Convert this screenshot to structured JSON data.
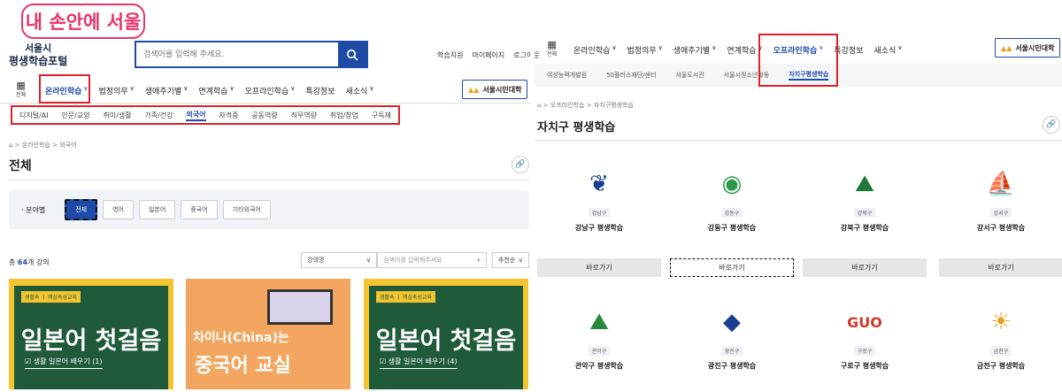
{
  "watermark": "내 손안에 서울",
  "left": {
    "brand": {
      "line1": "서울시",
      "line2": "평생학습포털"
    },
    "search": {
      "placeholder": "검색어를 입력해 주세요."
    },
    "top_links": [
      "학습지원",
      "마이페이지",
      "로그아웃"
    ],
    "grid_label": "전체",
    "gnb": [
      "온라인학습",
      "법정의무",
      "생애주기별",
      "연계학습",
      "오프라인학습",
      "특강정보",
      "새소식"
    ],
    "univ_button": "서울시민대학",
    "sub_menu": [
      "디지털/AI",
      "인문/교양",
      "취미/생활",
      "가족/건강",
      "외국어",
      "자격증",
      "공동역량",
      "직무역량",
      "취업/창업",
      "구독제"
    ],
    "breadcrumb": [
      "온라인학습",
      "외국어"
    ],
    "page_title": "전체",
    "filter": {
      "label": "분야별",
      "chips": [
        "전체",
        "영어",
        "일본어",
        "중국어",
        "기타외국어"
      ]
    },
    "count": {
      "prefix": "총 ",
      "num": "64",
      "suffix": "개 강의"
    },
    "sort_select": "강의명",
    "list_search_placeholder": "검색어를 입력해주세요",
    "order_select": "추천순",
    "cards": [
      {
        "tag": "생활속 ㅣ 핵심속성교육",
        "title": "일본어 첫걸음",
        "sub": "☑ 생활 일본어 배우기 (1)"
      },
      {
        "title1": "차이나(China)는",
        "title2": "중국어 교실"
      },
      {
        "tag": "생활속 ㅣ 핵심속성교육",
        "title": "일본어 첫걸음",
        "sub": "☑ 생활 일본어 배우기 (4)"
      }
    ]
  },
  "right": {
    "grid_label": "전체",
    "gnb": [
      "온라인학습",
      "법정의무",
      "생애주기별",
      "연계학습",
      "오프라인학습",
      "특강정보",
      "새소식"
    ],
    "univ_button": "서울시민대학",
    "sub_menu": [
      "여성능력개발원",
      "50플러스재단/센터",
      "서울도서관",
      "서울시청소년활동",
      "자치구평생학습"
    ],
    "breadcrumb": [
      "오프라인학습",
      "자치구평생학습"
    ],
    "page_title": "자치구 평생학습",
    "go_label": "바로가기",
    "districts": [
      {
        "tag": "강남구",
        "name": "강남구 평생학습"
      },
      {
        "tag": "강동구",
        "name": "강동구 평생학습"
      },
      {
        "tag": "강북구",
        "name": "강북구 평생학습"
      },
      {
        "tag": "강서구",
        "name": "강서구 평생학습"
      },
      {
        "tag": "관악구",
        "name": "관악구 평생학습"
      },
      {
        "tag": "광진구",
        "name": "광진구 평생학습"
      },
      {
        "tag": "구로구",
        "name": "구로구 평생학습"
      },
      {
        "tag": "금천구",
        "name": "금천구 평생학습"
      }
    ]
  }
}
